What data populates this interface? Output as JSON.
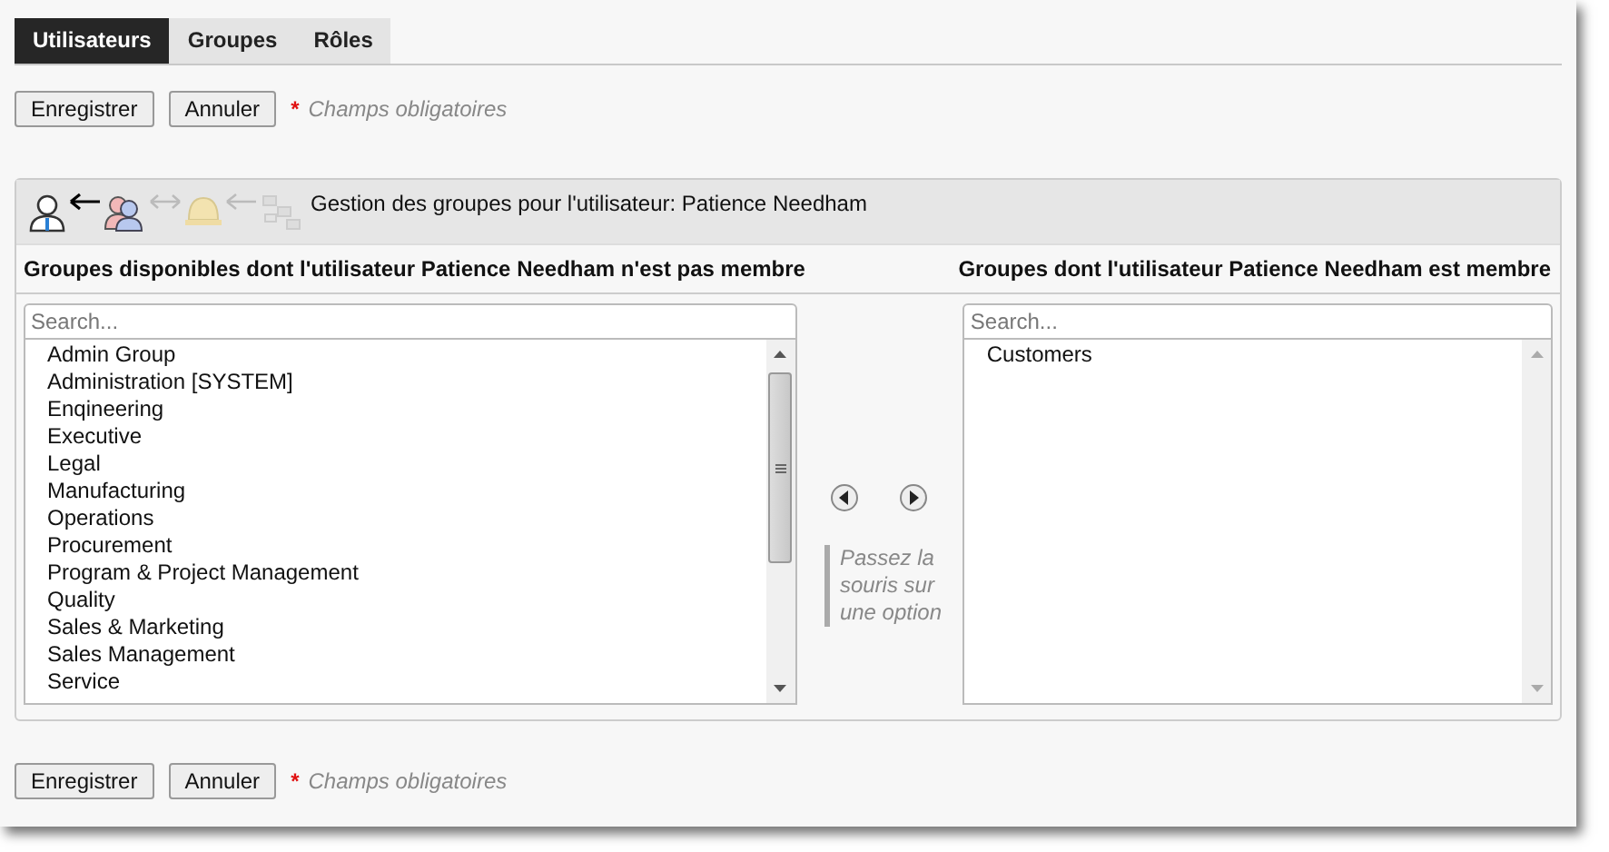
{
  "tabs": [
    {
      "label": "Utilisateurs",
      "selected": true
    },
    {
      "label": "Groupes",
      "selected": false
    },
    {
      "label": "Rôles",
      "selected": false
    }
  ],
  "top_actions": {
    "buttons": [
      "Enregistrer",
      "Annuler"
    ],
    "required_mark": "*",
    "required_note": "Champs obligatoires"
  },
  "panel": {
    "title": "Gestion des groupes pour l'utilisateur: Patience Needham",
    "available": {
      "heading": "Groupes disponibles dont l'utilisateur Patience Needham n'est pas membre",
      "search": {
        "placeholder": "Search..."
      },
      "items": [
        "Admin Group",
        "Administration [SYSTEM]",
        "Enqineering",
        "Executive",
        "Legal",
        "Manufacturing",
        "Operations",
        "Procurement",
        "Program & Project Management",
        "Quality",
        "Sales & Marketing",
        "Sales Management",
        "Service"
      ]
    },
    "hint": "Passez la souris sur une option",
    "member": {
      "heading": "Groupes dont l'utilisateur Patience Needham est membre",
      "search": {
        "placeholder": "Search..."
      },
      "items": [
        "Customers"
      ]
    }
  },
  "bottom_actions": {
    "buttons": [
      "Enregistrer",
      "Annuler"
    ],
    "required_mark": "*",
    "required_note": "Champs obligatoires"
  }
}
